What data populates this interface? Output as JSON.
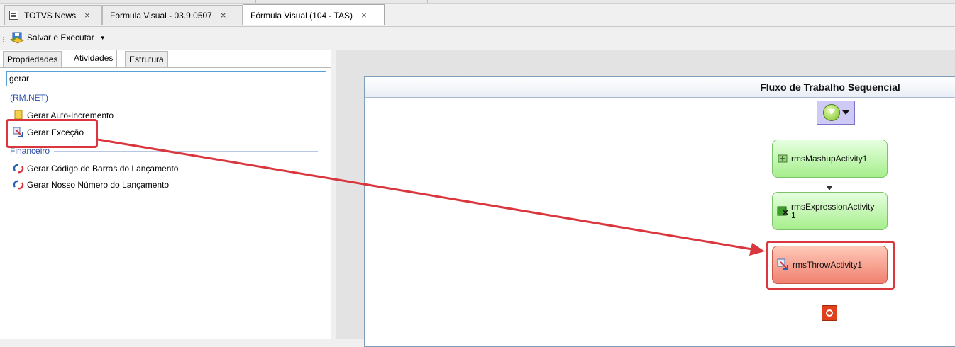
{
  "tabs": [
    {
      "label": "TOTVS News",
      "close": "×"
    },
    {
      "label": "Fórmula Visual - 03.9.0507",
      "close": "×"
    },
    {
      "label": "Fórmula Visual (104 - TAS)",
      "close": "×"
    }
  ],
  "toolbar": {
    "save_label": "Salvar e Executar",
    "dropdown": "▼"
  },
  "panel_tabs": [
    "Propriedades",
    "Atividades",
    "Estrutura"
  ],
  "search": {
    "value": "gerar"
  },
  "groups": [
    {
      "label": "(RM.NET)",
      "items": [
        {
          "label": "Gerar Auto-Incremento",
          "icon": "auto-increment-icon"
        },
        {
          "label": "Gerar Exceção",
          "icon": "throw-exception-icon"
        }
      ]
    },
    {
      "label": "Financeiro",
      "items": [
        {
          "label": "Gerar Código de Barras do Lançamento",
          "icon": "refresh-arrows-icon"
        },
        {
          "label": "Gerar Nosso Número do Lançamento",
          "icon": "refresh-arrows-icon"
        }
      ]
    }
  ],
  "workflow": {
    "title": "Fluxo de Trabalho Sequencial",
    "activities": [
      {
        "label": "rmsMashupActivity1",
        "icon": "mashup-icon"
      },
      {
        "label": "rmsExpressionActivity1",
        "icon": "expression-icon"
      },
      {
        "label": "rmsThrowActivity1",
        "icon": "throw-icon"
      }
    ]
  },
  "colors": {
    "highlight": "#d9363e",
    "activity_green": "#a6ee8c",
    "activity_red": "#f08070",
    "group_text": "#2a4fa8"
  }
}
